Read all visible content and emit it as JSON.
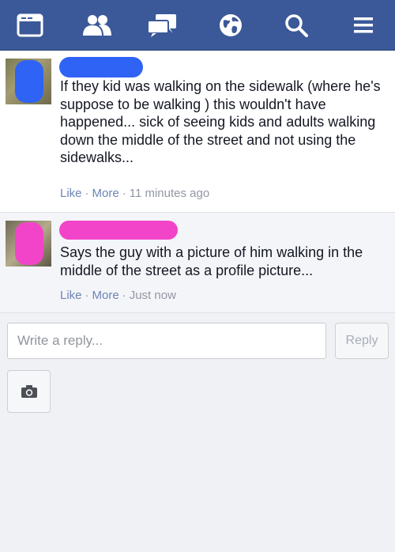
{
  "colors": {
    "topbar": "#3b5998",
    "icon": "#ffffff",
    "link": "#6d84b4",
    "meta": "#9197a3",
    "redact_blue": "#2f63f5",
    "redact_pink": "#f244c8"
  },
  "nav": [
    {
      "icon": "newsfeed-icon"
    },
    {
      "icon": "friends-icon"
    },
    {
      "icon": "messages-icon"
    },
    {
      "icon": "globe-icon"
    },
    {
      "icon": "search-icon"
    },
    {
      "icon": "menu-icon"
    }
  ],
  "comments": [
    {
      "text": "If they kid was walking on the sidewalk (where he's suppose to be walking ) this wouldn't have happened... sick of seeing kids and adults walking down the middle of the street and not using the sidewalks...",
      "like_label": "Like",
      "more_label": "More",
      "time": "11 minutes ago"
    },
    {
      "text": "Says the guy with a picture of him walking in the middle of the street as a profile picture...",
      "like_label": "Like",
      "more_label": "More",
      "time": "Just now"
    }
  ],
  "reply": {
    "placeholder": "Write a reply...",
    "button_label": "Reply",
    "camera_icon": "camera-icon"
  }
}
